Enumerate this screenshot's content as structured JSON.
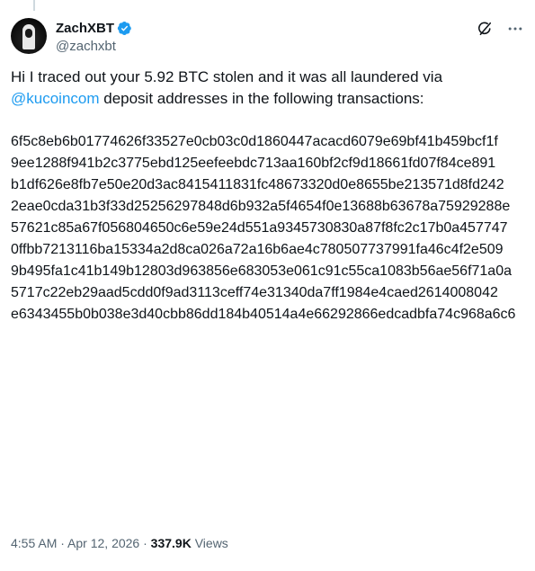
{
  "author": {
    "display_name": "ZachXBT",
    "handle": "@zachxbt",
    "verified": true
  },
  "tweet": {
    "text_before": "Hi I traced out your 5.92 BTC stolen and it was all laundered via",
    "mention": "@kucoincom",
    "text_after": " deposit addresses in the following transactions:",
    "hashes": [
      "6f5c8eb6b01774626f33527e0cb03c0d1860447acacd6079e69bf41b459bcf1f",
      "9ee1288f941b2c3775ebd125eefeebdc713aa160bf2cf9d18661fd07f84ce891",
      "b1df626e8fb7e50e20d3ac8415411831fc48673320d0e8655be213571d8fd242",
      "2eae0cda31b3f33d25256297848d6b932a5f4654f0e13688b63678a75929288e",
      "57621c85a67f056804650c6e59e24d551a9345730830a87f8fc2c17b0a457747",
      "0ffbb7213116ba15334a2d8ca026a72a16b6ae4c780507737991fa46c4f2e509",
      "9b495fa1c41b149b12803d963856e683053e061c91c55ca1083b56ae56f71a0a",
      "5717c22eb29aad5cdd0f9ad3113ceff74e31340da7ff1984e4caed2614008042",
      "e6343455b0b038e3d40cbb86dd184b40514a4e66292866edcadbfa74c968a6c6"
    ]
  },
  "meta": {
    "time": "4:55 AM",
    "separator_1": " · ",
    "date": "Apr 12, 2026",
    "separator_2": " · ",
    "views_count": "337.9K",
    "views_label": " Views"
  },
  "icons": {
    "verified": "verified-badge-icon",
    "grok": "grok-icon",
    "more": "more-options-icon"
  },
  "colors": {
    "accent": "#1d9bf0",
    "text": "#0f1419",
    "secondary": "#536471"
  }
}
